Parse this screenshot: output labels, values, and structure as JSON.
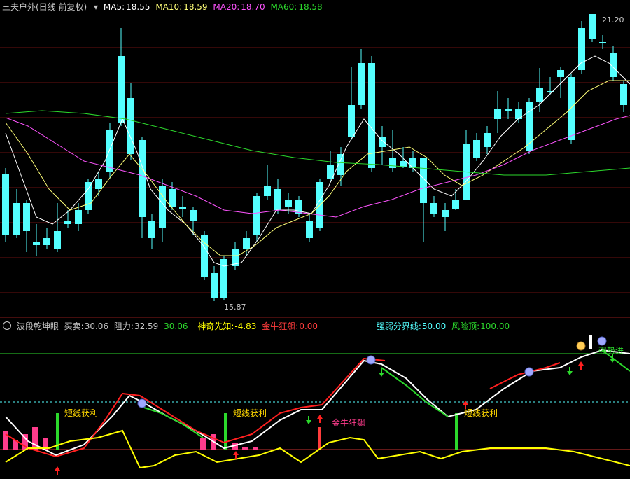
{
  "colors": {
    "background": "#000000",
    "up_candle": "#ff3c3c",
    "down_candle": "#54ffff",
    "ma5": "#ffffff",
    "ma10": "#ffff78",
    "ma20": "#ff54ff",
    "ma60": "#2cd92c",
    "label_default": "#c8c8c8",
    "resistance": "#ff4444",
    "green_value": "#2cd92c",
    "yellow_value": "#ffff00",
    "red_value": "#ff3c3c",
    "cyan_value": "#54ffff",
    "gold_label": "#ffd700",
    "pink_label": "#ff3c8c",
    "grid": "#6a1010"
  },
  "main_header": {
    "title": "三夫户外(日线 前复权)",
    "menu_icon": "chevron-down-icon",
    "ma5_label": "MA5:",
    "ma5_value": "18.55",
    "ma10_label": "MA10:",
    "ma10_value": "18.59",
    "ma20_label": "MA20:",
    "ma20_value": "18.70",
    "ma60_label": "MA60:",
    "ma60_value": "18.58"
  },
  "main_chart": {
    "high_label": "21.20",
    "low_label": "15.87"
  },
  "sub_header": {
    "indicator_name": "波段乾坤眼",
    "buy_sell_label": "买卖:",
    "buy_sell_value": "30.06",
    "resistance_label": "阻力:",
    "resistance_value": "32.59",
    "third_value": "30.06",
    "shenqi_label": "神奇先知:",
    "shenqi_value": "-4.83",
    "jinniu_label": "金牛狂飙:",
    "jinniu_value": "0.00",
    "strength_label": "强弱分界线:",
    "strength_value": "50.00",
    "risk_label": "风险顶:",
    "risk_value": "100.00"
  },
  "sub_chart": {
    "short_profit_label": "短线获利",
    "jinniu_signal_label": "金牛狂飙",
    "strong_enter_label": "强势进"
  }
}
